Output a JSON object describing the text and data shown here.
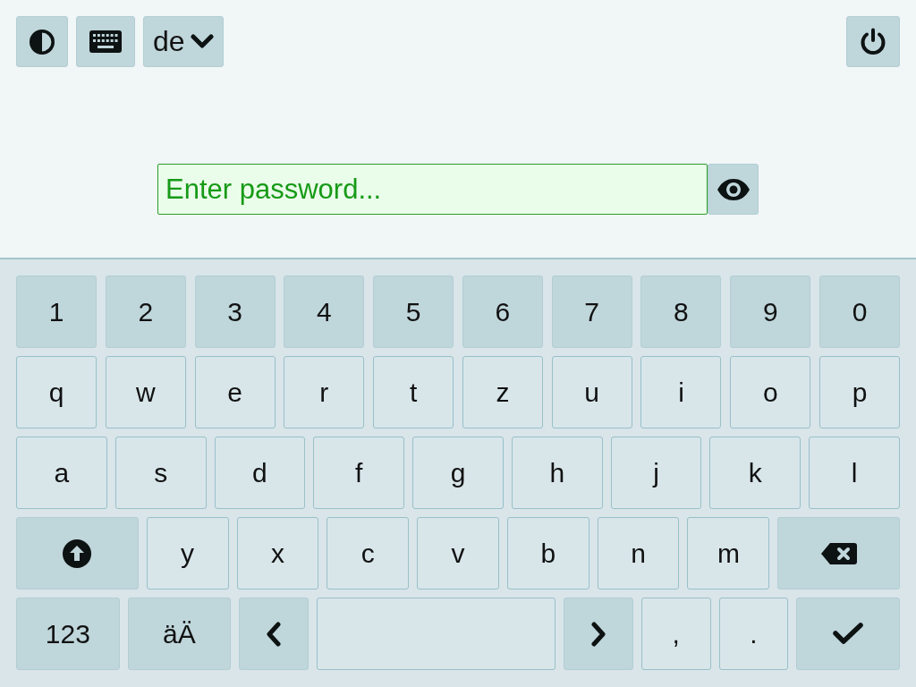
{
  "toolbar": {
    "language": "de"
  },
  "password_field": {
    "placeholder": "Enter password...",
    "focused": true
  },
  "keyboard": {
    "rows": [
      {
        "keys": [
          {
            "kind": "digit",
            "label": "1"
          },
          {
            "kind": "digit",
            "label": "2"
          },
          {
            "kind": "digit",
            "label": "3"
          },
          {
            "kind": "digit",
            "label": "4"
          },
          {
            "kind": "digit",
            "label": "5"
          },
          {
            "kind": "digit",
            "label": "6"
          },
          {
            "kind": "digit",
            "label": "7"
          },
          {
            "kind": "digit",
            "label": "8"
          },
          {
            "kind": "digit",
            "label": "9"
          },
          {
            "kind": "digit",
            "label": "0"
          }
        ]
      },
      {
        "keys": [
          {
            "kind": "letter",
            "label": "q"
          },
          {
            "kind": "letter",
            "label": "w"
          },
          {
            "kind": "letter",
            "label": "e"
          },
          {
            "kind": "letter",
            "label": "r"
          },
          {
            "kind": "letter",
            "label": "t"
          },
          {
            "kind": "letter",
            "label": "z"
          },
          {
            "kind": "letter",
            "label": "u"
          },
          {
            "kind": "letter",
            "label": "i"
          },
          {
            "kind": "letter",
            "label": "o"
          },
          {
            "kind": "letter",
            "label": "p"
          }
        ]
      },
      {
        "keys": [
          {
            "kind": "letter",
            "label": "a"
          },
          {
            "kind": "letter",
            "label": "s"
          },
          {
            "kind": "letter",
            "label": "d"
          },
          {
            "kind": "letter",
            "label": "f"
          },
          {
            "kind": "letter",
            "label": "g"
          },
          {
            "kind": "letter",
            "label": "h"
          },
          {
            "kind": "letter",
            "label": "j"
          },
          {
            "kind": "letter",
            "label": "k"
          },
          {
            "kind": "letter",
            "label": "l"
          }
        ]
      },
      {
        "keys": [
          {
            "kind": "shift"
          },
          {
            "kind": "letter",
            "label": "y"
          },
          {
            "kind": "letter",
            "label": "x"
          },
          {
            "kind": "letter",
            "label": "c"
          },
          {
            "kind": "letter",
            "label": "v"
          },
          {
            "kind": "letter",
            "label": "b"
          },
          {
            "kind": "letter",
            "label": "n"
          },
          {
            "kind": "letter",
            "label": "m"
          },
          {
            "kind": "backspace"
          }
        ]
      },
      {
        "keys": [
          {
            "kind": "mode",
            "label": "123"
          },
          {
            "kind": "mode",
            "label": "äÄ"
          },
          {
            "kind": "left"
          },
          {
            "kind": "space"
          },
          {
            "kind": "right"
          },
          {
            "kind": "letter",
            "label": ","
          },
          {
            "kind": "letter",
            "label": "."
          },
          {
            "kind": "enter"
          }
        ]
      }
    ]
  }
}
